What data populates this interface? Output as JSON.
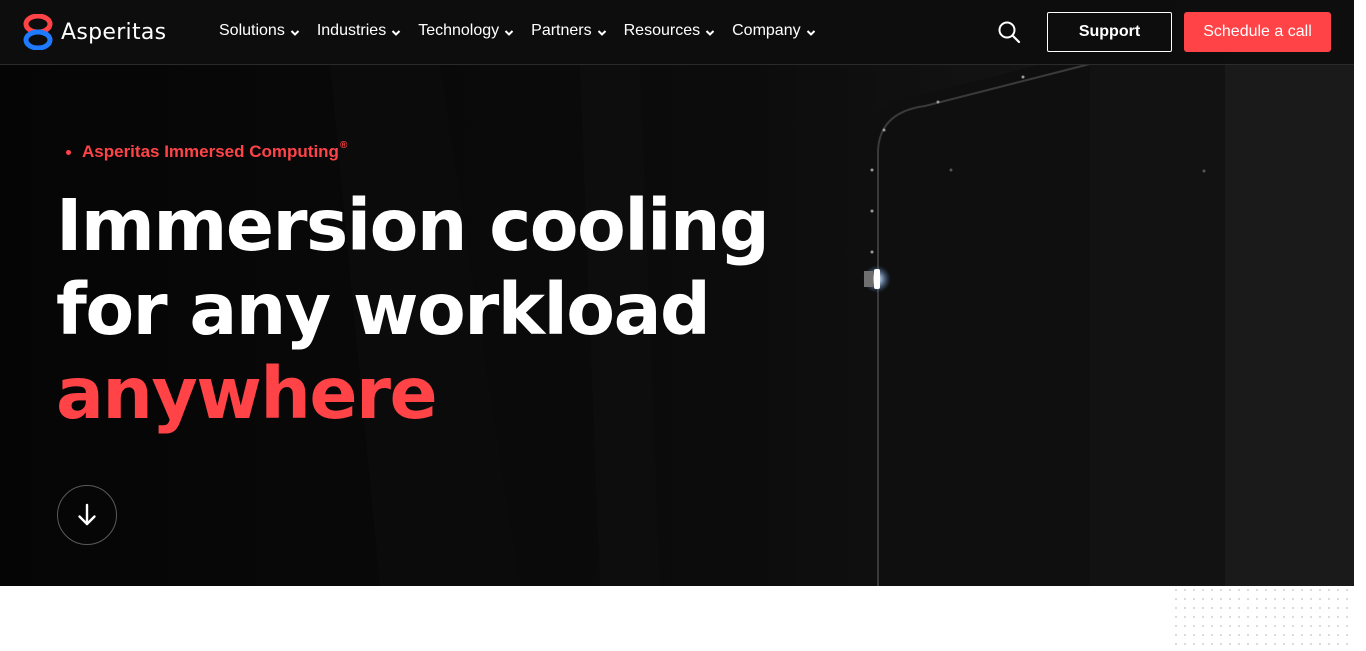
{
  "brand": {
    "name": "Asperitas",
    "accent_color": "#ff4347",
    "logo_top_color": "#ff4347",
    "logo_bottom_color": "#1e7bff"
  },
  "nav": {
    "items": [
      {
        "label": "Solutions",
        "icon": "chevron-down-icon"
      },
      {
        "label": "Industries",
        "icon": "chevron-down-icon"
      },
      {
        "label": "Technology",
        "icon": "chevron-down-icon"
      },
      {
        "label": "Partners",
        "icon": "chevron-down-icon"
      },
      {
        "label": "Resources",
        "icon": "chevron-down-icon"
      },
      {
        "label": "Company",
        "icon": "chevron-down-icon"
      }
    ],
    "search_icon": "search-icon",
    "support_label": "Support",
    "cta_label": "Schedule a call"
  },
  "hero": {
    "eyebrow": "Asperitas Immersed Computing",
    "eyebrow_mark": "®",
    "headline_line1": "Immersion cooling",
    "headline_line2": "for any workload",
    "headline_accent": "anywhere",
    "scroll_icon": "arrow-down-icon"
  }
}
